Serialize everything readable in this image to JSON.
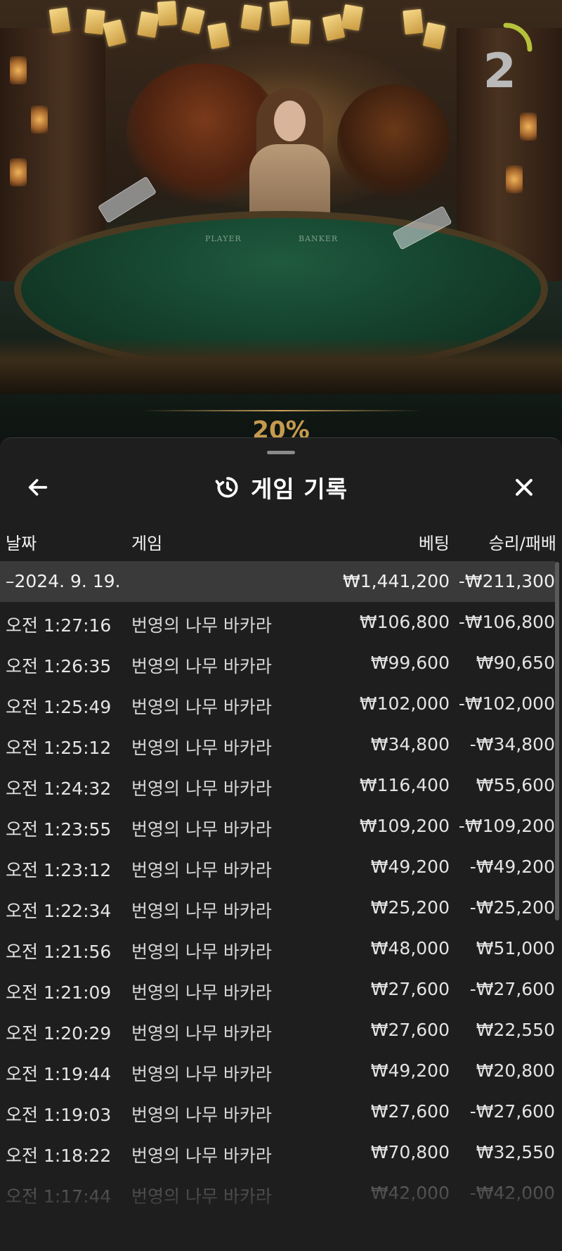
{
  "video": {
    "player_label": "PLAYER",
    "banker_label": "BANKER",
    "percent": "20%",
    "timer_value": "2"
  },
  "sheet": {
    "title": "게임 기록",
    "icons": {
      "back": "arrow-left-icon",
      "history": "history-clock-icon",
      "close": "close-icon"
    },
    "columns": {
      "date": "날짜",
      "game": "게임",
      "bet": "베팅",
      "result": "승리/패배"
    },
    "group": {
      "date": "–2024. 9. 19.",
      "bet": "₩1,441,200",
      "result": "-₩211,300"
    },
    "rows": [
      {
        "time": "오전 1:27:16",
        "game": "번영의 나무 바카라",
        "bet": "₩106,800",
        "result": "-₩106,800"
      },
      {
        "time": "오전 1:26:35",
        "game": "번영의 나무 바카라",
        "bet": "₩99,600",
        "result": "₩90,650"
      },
      {
        "time": "오전 1:25:49",
        "game": "번영의 나무 바카라",
        "bet": "₩102,000",
        "result": "-₩102,000"
      },
      {
        "time": "오전 1:25:12",
        "game": "번영의 나무 바카라",
        "bet": "₩34,800",
        "result": "-₩34,800"
      },
      {
        "time": "오전 1:24:32",
        "game": "번영의 나무 바카라",
        "bet": "₩116,400",
        "result": "₩55,600"
      },
      {
        "time": "오전 1:23:55",
        "game": "번영의 나무 바카라",
        "bet": "₩109,200",
        "result": "-₩109,200"
      },
      {
        "time": "오전 1:23:12",
        "game": "번영의 나무 바카라",
        "bet": "₩49,200",
        "result": "-₩49,200"
      },
      {
        "time": "오전 1:22:34",
        "game": "번영의 나무 바카라",
        "bet": "₩25,200",
        "result": "-₩25,200"
      },
      {
        "time": "오전 1:21:56",
        "game": "번영의 나무 바카라",
        "bet": "₩48,000",
        "result": "₩51,000"
      },
      {
        "time": "오전 1:21:09",
        "game": "번영의 나무 바카라",
        "bet": "₩27,600",
        "result": "-₩27,600"
      },
      {
        "time": "오전 1:20:29",
        "game": "번영의 나무 바카라",
        "bet": "₩27,600",
        "result": "₩22,550"
      },
      {
        "time": "오전 1:19:44",
        "game": "번영의 나무 바카라",
        "bet": "₩49,200",
        "result": "₩20,800"
      },
      {
        "time": "오전 1:19:03",
        "game": "번영의 나무 바카라",
        "bet": "₩27,600",
        "result": "-₩27,600"
      },
      {
        "time": "오전 1:18:22",
        "game": "번영의 나무 바카라",
        "bet": "₩70,800",
        "result": "₩32,550"
      },
      {
        "time": "오전 1:17:44",
        "game": "번영의 나무 바카라",
        "bet": "₩42,000",
        "result": "-₩42,000"
      }
    ]
  }
}
